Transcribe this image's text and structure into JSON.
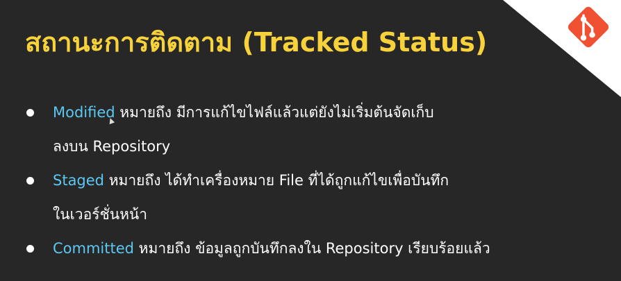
{
  "slide": {
    "title": "สถานะการติดตาม (Tracked Status)",
    "logo_icon": "git-icon",
    "colors": {
      "background": "#272727",
      "title": "#f7d23a",
      "term": "#5cc8f2",
      "text": "#ffffff",
      "logo": "#f05133"
    },
    "bullets": [
      {
        "term": "Modified",
        "line1": " หมายถึง มีการแก้ไขไฟล์แล้วแต่ยังไม่เริ่มต้นจัดเก็บ",
        "line2": "ลงบน Repository"
      },
      {
        "term": "Staged",
        "line1": " หมายถึง ได้ทำเครื่องหมาย File ที่ได้ถูกแก้ไขเพื่อบันทึก",
        "line2": "ในเวอร์ชั่นหน้า"
      },
      {
        "term": "Committed",
        "line1": " หมายถึง ข้อมูลถูกบันทึกลงใน Repository เรียบร้อยแล้ว"
      }
    ]
  }
}
